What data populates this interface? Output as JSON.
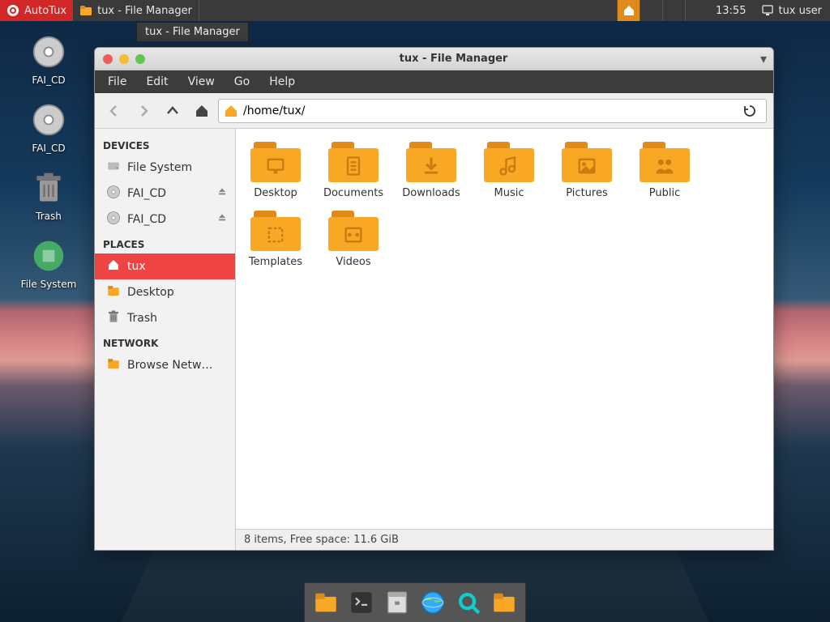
{
  "panel": {
    "app_button": "AutoTux",
    "task_button": "tux - File Manager",
    "tooltip": "tux - File Manager",
    "clock": "13:55",
    "user": "tux user"
  },
  "desktop_icons": [
    {
      "label": "FAI_CD",
      "kind": "disc"
    },
    {
      "label": "FAI_CD",
      "kind": "disc"
    },
    {
      "label": "Trash",
      "kind": "trash"
    },
    {
      "label": "File System",
      "kind": "disk"
    }
  ],
  "window": {
    "title": "tux - File Manager",
    "menubar": [
      "File",
      "Edit",
      "View",
      "Go",
      "Help"
    ],
    "path": "/home/tux/",
    "status": "8 items, Free space: 11.6 GiB"
  },
  "sidebar": {
    "sections": [
      {
        "header": "DEVICES",
        "items": [
          {
            "label": "File System",
            "icon": "drive",
            "eject": false
          },
          {
            "label": "FAI_CD",
            "icon": "disc",
            "eject": true
          },
          {
            "label": "FAI_CD",
            "icon": "disc",
            "eject": true
          }
        ]
      },
      {
        "header": "PLACES",
        "items": [
          {
            "label": "tux",
            "icon": "home",
            "active": true
          },
          {
            "label": "Desktop",
            "icon": "folder"
          },
          {
            "label": "Trash",
            "icon": "trash"
          }
        ]
      },
      {
        "header": "NETWORK",
        "items": [
          {
            "label": "Browse Netw…",
            "icon": "folder"
          }
        ]
      }
    ]
  },
  "folders": [
    {
      "label": "Desktop",
      "glyph": "monitor"
    },
    {
      "label": "Documents",
      "glyph": "doc"
    },
    {
      "label": "Downloads",
      "glyph": "download"
    },
    {
      "label": "Music",
      "glyph": "music"
    },
    {
      "label": "Pictures",
      "glyph": "image"
    },
    {
      "label": "Public",
      "glyph": "people"
    },
    {
      "label": "Templates",
      "glyph": "template"
    },
    {
      "label": "Videos",
      "glyph": "video"
    }
  ],
  "dock": [
    {
      "name": "files",
      "glyph": "folder"
    },
    {
      "name": "terminal",
      "glyph": "terminal"
    },
    {
      "name": "archive",
      "glyph": "archive"
    },
    {
      "name": "browser",
      "glyph": "globe"
    },
    {
      "name": "search",
      "glyph": "search"
    },
    {
      "name": "folder2",
      "glyph": "folder"
    }
  ]
}
